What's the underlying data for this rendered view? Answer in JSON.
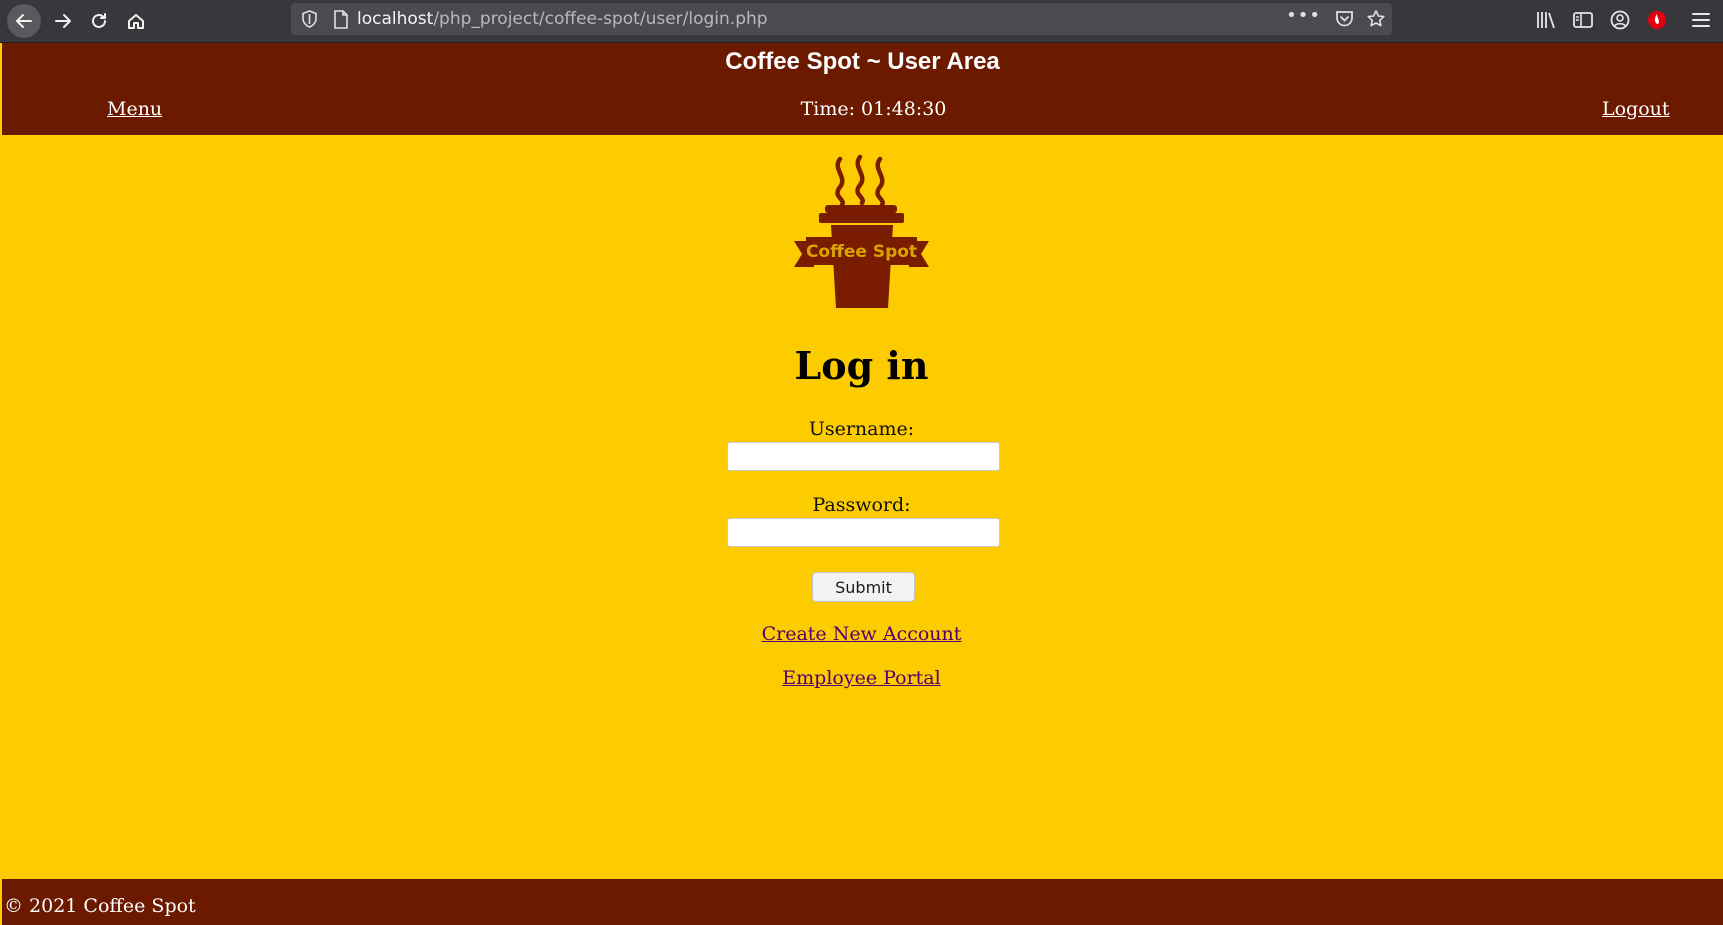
{
  "browser": {
    "url_host": "localhost",
    "url_path": "/php_project/coffee-spot/user/login.php",
    "url_dots": "•••"
  },
  "header": {
    "title": "Coffee Spot ~ User Area",
    "menu_label": "Menu",
    "time_text": "Time: 01:48:30",
    "logout_label": "Logout"
  },
  "logo": {
    "text": "Coffee Spot"
  },
  "login": {
    "heading": "Log in",
    "username_label": "Username:",
    "username_value": "",
    "password_label": "Password:",
    "password_value": "",
    "submit_label": "Submit"
  },
  "links": {
    "create_account": "Create New Account",
    "employee_portal": "Employee Portal"
  },
  "footer": {
    "text": "© 2021 Coffee Spot"
  },
  "colors": {
    "header_bg": "#6B1A00",
    "page_bg": "#FCCC00",
    "link": "#55006a",
    "logo_cup": "#7a1c00",
    "logo_text": "#d9a300"
  }
}
